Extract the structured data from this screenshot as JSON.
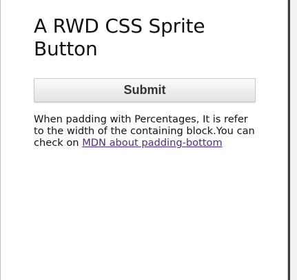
{
  "page": {
    "title": "A RWD CSS Sprite Button"
  },
  "form": {
    "submit_label": "Submit"
  },
  "description": {
    "text": "When padding with Percentages, It is refer to the width of the containing block.You can check on ",
    "link_text": "MDN about padding-bottom"
  },
  "colors": {
    "background": "#ffffff",
    "text": "#111111",
    "link": "#4b2e83",
    "button_text": "#333333",
    "button_border": "#c9c9c9"
  }
}
